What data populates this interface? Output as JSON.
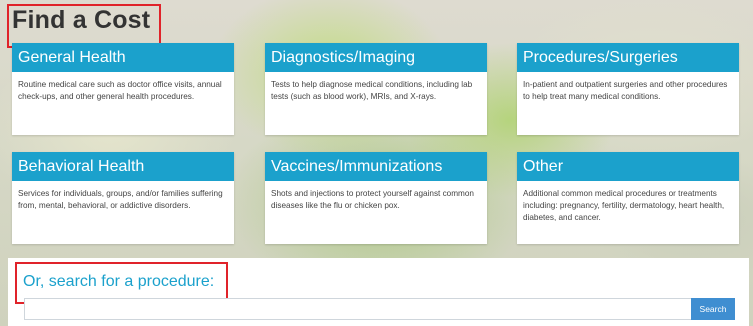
{
  "page": {
    "title": "Find a Cost"
  },
  "categories": [
    {
      "title": "General Health",
      "description": "Routine medical care such as doctor office visits, annual check-ups, and other general health procedures."
    },
    {
      "title": "Diagnostics/Imaging",
      "description": "Tests to help diagnose medical conditions, including lab tests (such as blood work), MRIs, and X-rays."
    },
    {
      "title": "Procedures/Surgeries",
      "description": "In-patient and outpatient surgeries and other procedures to help treat many medical conditions."
    },
    {
      "title": "Behavioral Health",
      "description": "Services for individuals, groups, and/or families suffering from, mental, behavioral, or addictive disorders."
    },
    {
      "title": "Vaccines/Immunizations",
      "description": "Shots and injections to protect yourself against common diseases like the flu or chicken pox."
    },
    {
      "title": "Other",
      "description": "Additional common medical procedures or treatments including: pregnancy, fertility, dermatology, heart health, diabetes, and cancer."
    }
  ],
  "search": {
    "label": "Or, search for a procedure:",
    "input_value": "",
    "button_label": "Search"
  },
  "colors": {
    "accent": "#1ba1cc",
    "button": "#3f8ed1",
    "highlight": "#e0232a"
  }
}
